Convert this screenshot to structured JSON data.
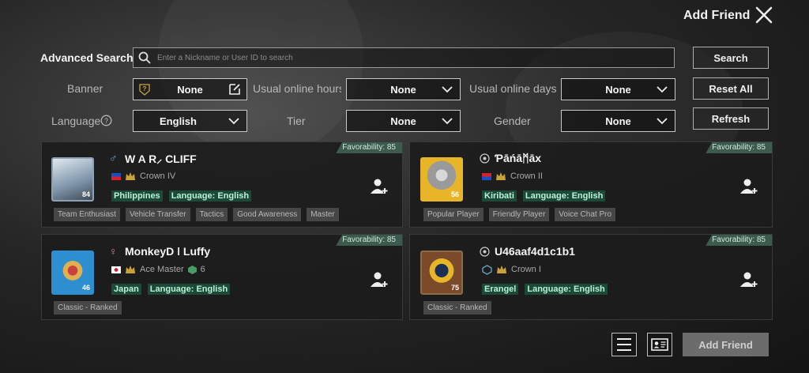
{
  "header": {
    "title": "Add Friend"
  },
  "search": {
    "label": "Advanced Search",
    "placeholder": "Enter a Nickname or User ID to search",
    "search_button": "Search",
    "reset_button": "Reset All",
    "refresh_button": "Refresh"
  },
  "filters": {
    "banner_label": "Banner",
    "banner_value": "None",
    "online_hours_label": "Usual online hours",
    "online_hours_value": "None",
    "online_days_label": "Usual online days",
    "online_days_value": "None",
    "language_label": "Language",
    "language_value": "English",
    "tier_label": "Tier",
    "tier_value": "None",
    "gender_label": "Gender",
    "gender_value": "None"
  },
  "players": [
    {
      "favorability": "Favorability: 85",
      "gender_symbol": "♂",
      "name": "W A R⸝ CLIFF",
      "rank": "Crown IV",
      "level": "84",
      "region": "Philippines",
      "language": "Language: English",
      "tags": [
        "Team Enthusiast",
        "Vehicle Transfer",
        "Tactics",
        "Good Awareness",
        "Master"
      ]
    },
    {
      "favorability": "Favorability: 85",
      "gender_symbol": "",
      "name": "Ƥāńāᛗāx",
      "rank": "Crown II",
      "level": "56",
      "region": "Kiribati",
      "language": "Language: English",
      "tags": [
        "Popular Player",
        "Friendly Player",
        "Voice Chat Pro"
      ]
    },
    {
      "favorability": "Favorability: 85",
      "gender_symbol": "♀",
      "name": "MonkeyD ǀ Luffy",
      "rank": "Ace Master",
      "rank_extra": "6",
      "level": "46",
      "region": "Japan",
      "language": "Language: English",
      "tags": [
        "Classic - Ranked"
      ]
    },
    {
      "favorability": "Favorability: 85",
      "gender_symbol": "",
      "name": "U46aaf4d1c1b1",
      "rank": "Crown I",
      "level": "75",
      "region": "Erangel",
      "language": "Language: English",
      "tags": [
        "Classic - Ranked"
      ]
    }
  ],
  "footer": {
    "add_friend_button": "Add Friend"
  },
  "colors": {
    "accent_green": "#3d5a4e",
    "tag_green_text": "#b8f2d7"
  }
}
